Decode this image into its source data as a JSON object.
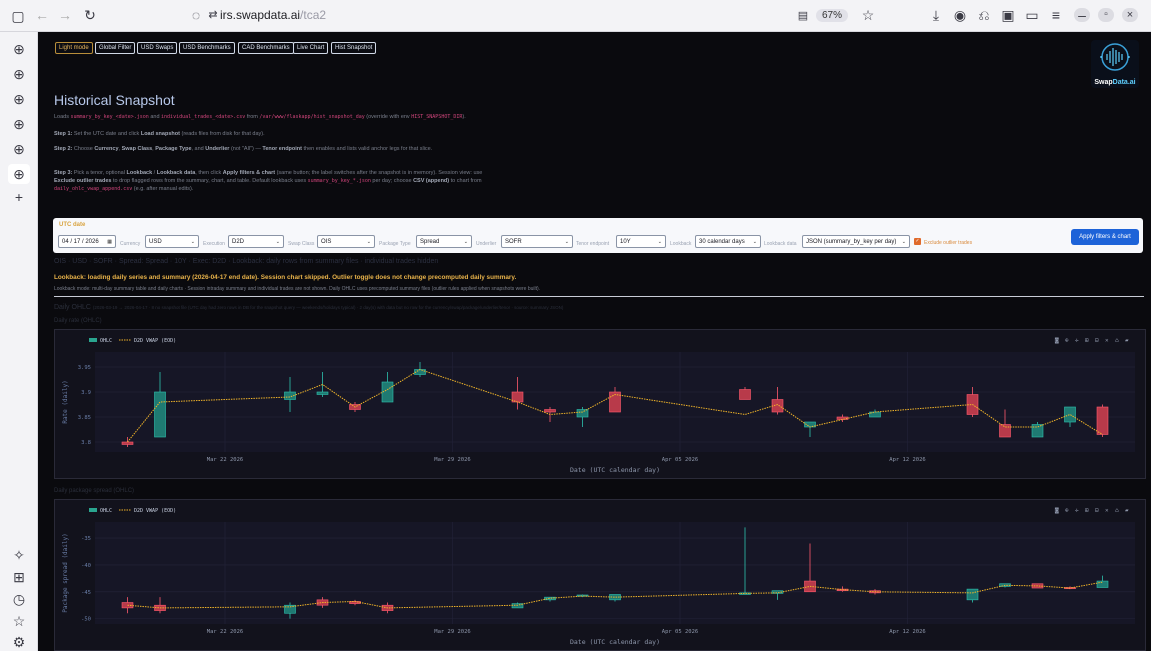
{
  "browser": {
    "url_host": "irs.swapdata.ai",
    "url_path": "/tca2",
    "zoom": "67%"
  },
  "nav": {
    "buttons": [
      "Light mode",
      "Global Filter",
      "USD Swaps",
      "USD Benchmarks",
      "CAD Benchmarks",
      "Live Chart",
      "Hist Snapshot"
    ]
  },
  "logo": {
    "text_a": "Swap",
    "text_b": "Data.ai"
  },
  "page": {
    "title": "Historical Snapshot",
    "intro_1": "Loads ",
    "intro_code_1": "summary_by_key_<date>.json",
    "intro_2": " and ",
    "intro_code_2": "individual_trades_<date>.csv",
    "intro_3": " from ",
    "intro_code_3": "/var/www/flaskapp/hist_snapshot_day",
    "intro_4": " (override with env ",
    "intro_code_4": "HIST_SNAPSHOT_DIR",
    "intro_5": ").",
    "step1_label": "Step 1:",
    "step1_a": " Set the UTC date and click ",
    "step1_b": "Load snapshot",
    "step1_c": " (reads files from disk for that day).",
    "step2_label": "Step 2:",
    "step2_a": " Choose ",
    "step2_b": "Currency",
    "step2_c": ", ",
    "step2_d": "Swap Class",
    "step2_e": ", ",
    "step2_f": "Package Type",
    "step2_g": ", and ",
    "step2_h": "Underlier",
    "step2_i": " (not \"All\") — ",
    "step2_j": "Tenor endpoint",
    "step2_k": " then enables and lists valid anchor legs for that slice.",
    "step3_label": "Step 3:",
    "step3_a": " Pick a tenor, optional ",
    "step3_b": "Lookback",
    "step3_c": " / ",
    "step3_d": "Lookback data",
    "step3_e": ", then click ",
    "step3_f": "Apply filters & chart",
    "step3_g": " (same button; the label switches after the snapshot is in memory). Session view: use ",
    "step3_h": "Exclude outlier trades",
    "step3_i": " to drop flagged rows from the summary, chart, and table. Default lookback uses ",
    "step3_code_1": "summary_by_key_*.json",
    "step3_j": " per day; choose ",
    "step3_k": "CSV (append)",
    "step3_l": " to chart from ",
    "step3_code_2": "daily_ohlc_vwap_append.csv",
    "step3_m": " (e.g. after manual edits)."
  },
  "filters": {
    "utc_label": "UTC date",
    "date": "04 / 17 / 2026",
    "currency_label": "Currency",
    "currency": "USD",
    "execution_label": "Execution",
    "execution": "D2D",
    "swapclass_label": "Swap Class",
    "swapclass": "OIS",
    "package_label": "Package Type",
    "package": "Spread",
    "underlier_label": "Underlier",
    "underlier": "SOFR",
    "tenor_label": "Tenor endpoint",
    "tenor": "10Y",
    "lookback_label": "Lookback",
    "lookback": "30 calendar days",
    "lookbackdata_label": "Lookback data",
    "lookbackdata": "JSON (summary_by_key per day)",
    "exclude_label": "Exclude outlier trades",
    "apply_label": "Apply filters & chart"
  },
  "status": {
    "breadcrumb": "OIS · USD · SOFR · Spread: Spread · 10Y · Exec: D2D · Lookback: daily rows from summary files · individual trades hidden",
    "lookback_msg": "Lookback: loading daily series and summary (2026-04-17 end date). Session chart skipped. Outlier toggle does not change precomputed daily summary.",
    "mode_msg": "Lookback mode: multi-day summary table and daily charts · Session intraday summary and individual trades are not shown. Daily OHLC uses precomputed summary files (outlier rules applied when snapshots were built)."
  },
  "daily": {
    "heading": "Daily OHLC",
    "meta": "(2026-03-19 → 2026-04-17 · 8 no snapshot file (UTC day had zero rows in DB for the snapshot query — weekends/holidays typical) · 2 day(s) with data but no row for the currency/swap/package/underlier/tenor · source: summary JSON)"
  },
  "chart_data": [
    {
      "type": "candlestick",
      "title": "Daily rate (OHLC)",
      "xlabel": "Date (UTC calendar day)",
      "ylabel": "Rate (daily)",
      "ylim": [
        3.78,
        3.98
      ],
      "yticks": [
        3.8,
        3.85,
        3.9,
        3.95
      ],
      "xticks": [
        "Mar 22 2026",
        "Mar 29 2026",
        "Apr 05 2026",
        "Apr 12 2026"
      ],
      "legend": [
        "OHLC",
        "D2D VWAP (EOD)"
      ],
      "candles": [
        {
          "x": "2026-03-19",
          "o": 3.8,
          "h": 3.81,
          "l": 3.79,
          "c": 3.795
        },
        {
          "x": "2026-03-20",
          "o": 3.81,
          "h": 3.94,
          "l": 3.81,
          "c": 3.9
        },
        {
          "x": "2026-03-24",
          "o": 3.885,
          "h": 3.93,
          "l": 3.86,
          "c": 3.9
        },
        {
          "x": "2026-03-25",
          "o": 3.895,
          "h": 3.94,
          "l": 3.89,
          "c": 3.9
        },
        {
          "x": "2026-03-26",
          "o": 3.875,
          "h": 3.88,
          "l": 3.86,
          "c": 3.865
        },
        {
          "x": "2026-03-27",
          "o": 3.88,
          "h": 3.94,
          "l": 3.88,
          "c": 3.92
        },
        {
          "x": "2026-03-28",
          "o": 3.935,
          "h": 3.96,
          "l": 3.93,
          "c": 3.945
        },
        {
          "x": "2026-03-31",
          "o": 3.9,
          "h": 3.93,
          "l": 3.865,
          "c": 3.88
        },
        {
          "x": "2026-04-01",
          "o": 3.865,
          "h": 3.87,
          "l": 3.84,
          "c": 3.86
        },
        {
          "x": "2026-04-02",
          "o": 3.85,
          "h": 3.87,
          "l": 3.83,
          "c": 3.865
        },
        {
          "x": "2026-04-03",
          "o": 3.9,
          "h": 3.91,
          "l": 3.86,
          "c": 3.86
        },
        {
          "x": "2026-04-07",
          "o": 3.905,
          "h": 3.91,
          "l": 3.885,
          "c": 3.885
        },
        {
          "x": "2026-04-08",
          "o": 3.885,
          "h": 3.91,
          "l": 3.855,
          "c": 3.86
        },
        {
          "x": "2026-04-09",
          "o": 3.83,
          "h": 3.84,
          "l": 3.81,
          "c": 3.84
        },
        {
          "x": "2026-04-10",
          "o": 3.85,
          "h": 3.855,
          "l": 3.84,
          "c": 3.845
        },
        {
          "x": "2026-04-11",
          "o": 3.85,
          "h": 3.865,
          "l": 3.85,
          "c": 3.86
        },
        {
          "x": "2026-04-14",
          "o": 3.895,
          "h": 3.91,
          "l": 3.85,
          "c": 3.855
        },
        {
          "x": "2026-04-15",
          "o": 3.835,
          "h": 3.865,
          "l": 3.81,
          "c": 3.81
        },
        {
          "x": "2026-04-16",
          "o": 3.81,
          "h": 3.84,
          "l": 3.81,
          "c": 3.835
        },
        {
          "x": "2026-04-17",
          "o": 3.84,
          "h": 3.87,
          "l": 3.83,
          "c": 3.87
        },
        {
          "x": "2026-04-18",
          "o": 3.87,
          "h": 3.875,
          "l": 3.81,
          "c": 3.815
        }
      ],
      "vwap": [
        3.8,
        3.88,
        3.89,
        3.915,
        3.87,
        3.905,
        3.945,
        3.88,
        3.855,
        3.86,
        3.895,
        3.855,
        3.875,
        3.83,
        3.845,
        3.86,
        3.875,
        3.83,
        3.83,
        3.855,
        3.815
      ]
    },
    {
      "type": "candlestick",
      "title": "Daily package spread (OHLC)",
      "xlabel": "Date (UTC calendar day)",
      "ylabel": "Package spread (daily)",
      "ylim": [
        -51,
        -32
      ],
      "yticks": [
        -50,
        -45,
        -40,
        -35
      ],
      "xticks": [
        "Mar 22 2026",
        "Mar 29 2026",
        "Apr 05 2026",
        "Apr 12 2026"
      ],
      "legend": [
        "OHLC",
        "D2D VWAP (EOD)"
      ],
      "candles": [
        {
          "x": "2026-03-19",
          "o": -47,
          "h": -46,
          "l": -49,
          "c": -48
        },
        {
          "x": "2026-03-20",
          "o": -47.5,
          "h": -46,
          "l": -49,
          "c": -48.5
        },
        {
          "x": "2026-03-24",
          "o": -49,
          "h": -47,
          "l": -50,
          "c": -47.5
        },
        {
          "x": "2026-03-25",
          "o": -46.5,
          "h": -46,
          "l": -48,
          "c": -47.5
        },
        {
          "x": "2026-03-26",
          "o": -46.8,
          "h": -46.5,
          "l": -47.5,
          "c": -47.2
        },
        {
          "x": "2026-03-27",
          "o": -47.5,
          "h": -47,
          "l": -49,
          "c": -48.5
        },
        {
          "x": "2026-03-31",
          "o": -48,
          "h": -47,
          "l": -48,
          "c": -47.2
        },
        {
          "x": "2026-04-01",
          "o": -46.5,
          "h": -46,
          "l": -46.8,
          "c": -46
        },
        {
          "x": "2026-04-02",
          "o": -45.8,
          "h": -45.5,
          "l": -46,
          "c": -45.6
        },
        {
          "x": "2026-04-03",
          "o": -46.5,
          "h": -45.5,
          "l": -46.8,
          "c": -45.5
        },
        {
          "x": "2026-04-07",
          "o": -45.5,
          "h": -33,
          "l": -45.5,
          "c": -45.2
        },
        {
          "x": "2026-04-08",
          "o": -45.3,
          "h": -45,
          "l": -46.5,
          "c": -44.8
        },
        {
          "x": "2026-04-09",
          "o": -43,
          "h": -36,
          "l": -45,
          "c": -45
        },
        {
          "x": "2026-04-10",
          "o": -44.5,
          "h": -44,
          "l": -45,
          "c": -44.8
        },
        {
          "x": "2026-04-11",
          "o": -44.8,
          "h": -44.5,
          "l": -45.5,
          "c": -45.2
        },
        {
          "x": "2026-04-14",
          "o": -46.5,
          "h": -44.5,
          "l": -47,
          "c": -44.5
        },
        {
          "x": "2026-04-15",
          "o": -44,
          "h": -43.8,
          "l": -44.2,
          "c": -43.5
        },
        {
          "x": "2026-04-16",
          "o": -43.5,
          "h": -43.5,
          "l": -44.3,
          "c": -44.3
        },
        {
          "x": "2026-04-17",
          "o": -44.2,
          "h": -44,
          "l": -44.5,
          "c": -44.3
        },
        {
          "x": "2026-04-18",
          "o": -44.2,
          "h": -42,
          "l": -44.2,
          "c": -43
        }
      ],
      "vwap": [
        -47.5,
        -48,
        -47.8,
        -47,
        -46.8,
        -48,
        -47.5,
        -46.2,
        -45.8,
        -46,
        -45.3,
        -45.2,
        -44,
        -44.6,
        -45,
        -45.2,
        -43.8,
        -43.9,
        -44.3,
        -43.2
      ]
    }
  ]
}
